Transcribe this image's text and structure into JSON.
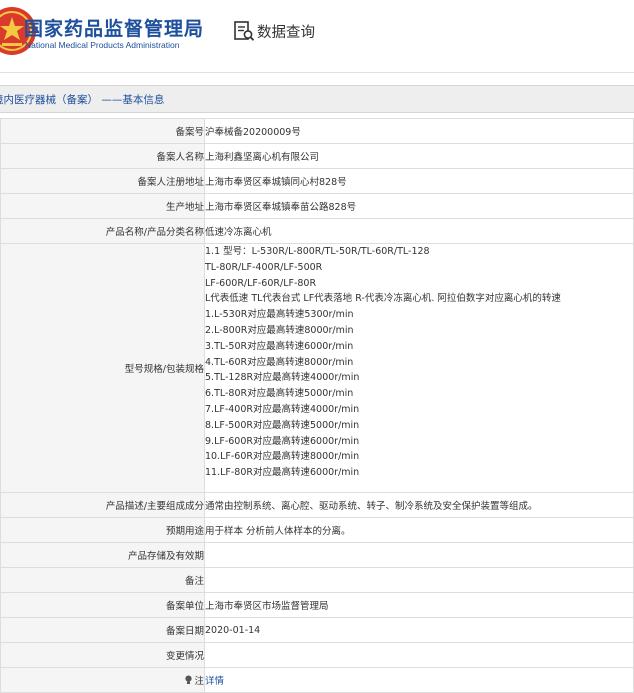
{
  "header": {
    "title_cn": "国家药品监督管理局",
    "title_en": "National Medical Products Administration",
    "search_label": "数据查询",
    "logo_icon": "nmpa-emblem-icon",
    "search_icon": "document-search-icon"
  },
  "section": {
    "title": "境内医疗器械（备案） ——基本信息"
  },
  "rows": [
    {
      "label": "备案号",
      "value": "沪奉械备20200009号"
    },
    {
      "label": "备案人名称",
      "value": "上海利鑫坚离心机有限公司"
    },
    {
      "label": "备案人注册地址",
      "value": "上海市奉贤区奉城镇同心村828号"
    },
    {
      "label": "生产地址",
      "value": "上海市奉贤区奉城镇奉苗公路828号"
    },
    {
      "label": "产品名称/产品分类名称",
      "value": "低速冷冻离心机"
    }
  ],
  "spec": {
    "label": "型号规格/包装规格",
    "lines": [
      "1.1 型号：L-530R/L-800R/TL-50R/TL-60R/TL-128",
      "TL-80R/LF-400R/LF-500R",
      "LF-600R/LF-60R/LF-80R",
      "L代表低速 TL代表台式 LF代表落地 R-代表冷冻离心机. 阿拉伯数字对应离心机的转速",
      "1.L-530R对应最高转速5300r/min",
      "2.L-800R对应最高转速8000r/min",
      "3.TL-50R对应最高转速6000r/min",
      "4.TL-60R对应最高转速8000r/min",
      "5.TL-128R对应最高转速4000r/min",
      "6.TL-80R对应最高转速5000r/min",
      "7.LF-400R对应最高转速4000r/min",
      "8.LF-500R对应最高转速5000r/min",
      "9.LF-600R对应最高转速6000r/min",
      "10.LF-60R对应最高转速8000r/min",
      "11.LF-80R对应最高转速6000r/min"
    ]
  },
  "rows2": [
    {
      "label": "产品描述/主要组成成分",
      "value": "通常由控制系统、离心腔、驱动系统、转子、制冷系统及安全保护装置等组成。"
    },
    {
      "label": "预期用途",
      "value": "用于样本 分析前人体样本的分离。"
    },
    {
      "label": "产品存储及有效期",
      "value": ""
    },
    {
      "label": "备注",
      "value": ""
    },
    {
      "label": "备案单位",
      "value": "上海市奉贤区市场监督管理局"
    },
    {
      "label": "备案日期",
      "value": "2020-01-14"
    },
    {
      "label": "变更情况",
      "value": ""
    }
  ],
  "note_row": {
    "label": "注",
    "link": "详情",
    "icon": "lightbulb-icon"
  },
  "colors": {
    "brand_blue": "#1d4f9c",
    "label_bg": "#f5f5f5",
    "bar_bg": "#eeeeee",
    "border": "#dddddd"
  }
}
